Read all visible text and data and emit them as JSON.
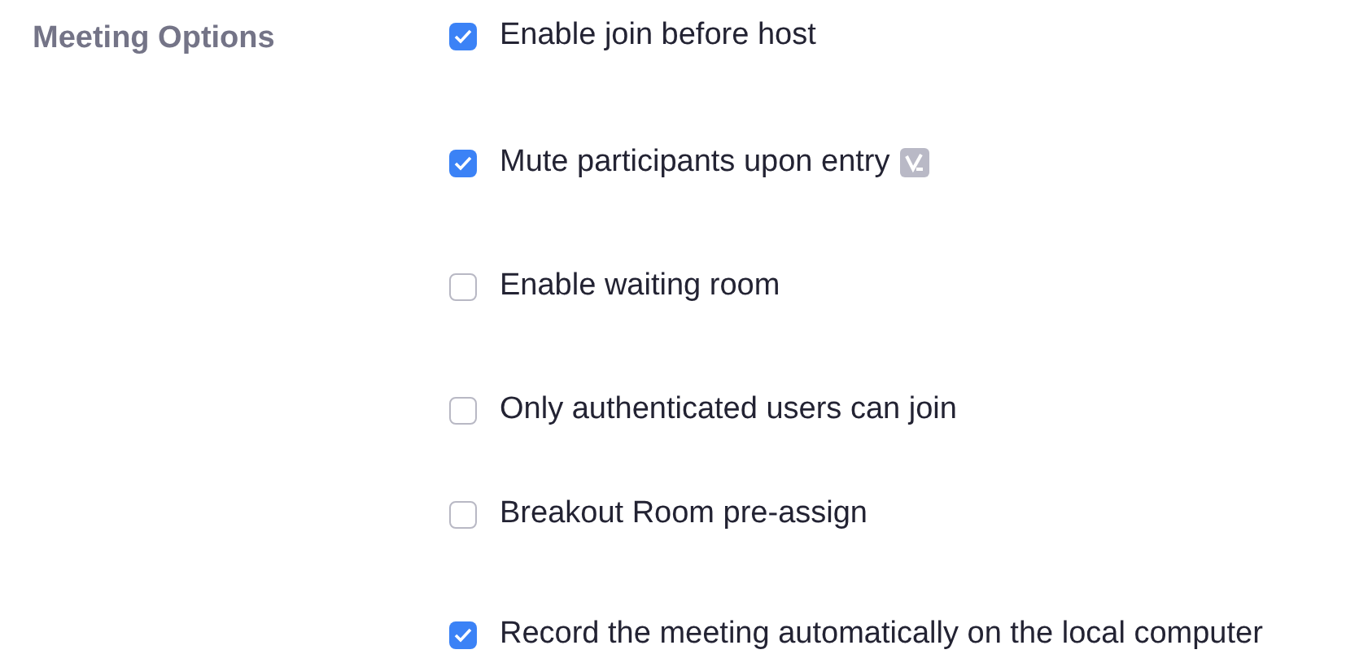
{
  "section": {
    "title": "Meeting Options"
  },
  "options": [
    {
      "label": "Enable join before host",
      "checked": true
    },
    {
      "label": "Mute participants upon entry",
      "checked": true,
      "badge": true
    },
    {
      "label": "Enable waiting room",
      "checked": false
    },
    {
      "label": "Only authenticated users can join",
      "checked": false
    },
    {
      "label": "Breakout Room pre-assign",
      "checked": false
    },
    {
      "label": "Record the meeting automatically on the local computer",
      "checked": true
    }
  ]
}
